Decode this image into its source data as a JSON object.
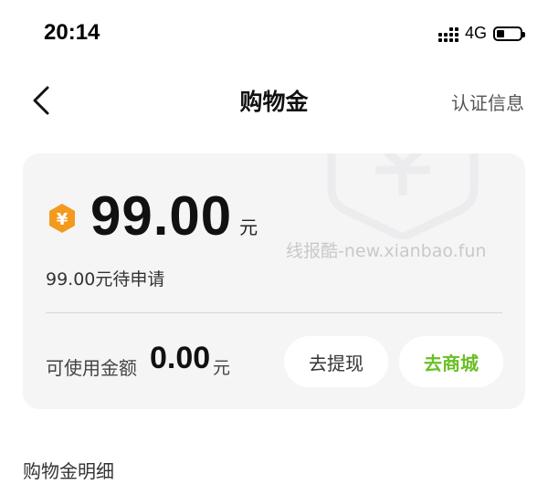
{
  "status_bar": {
    "time": "20:14",
    "network": "4G",
    "icons": [
      "signal-icon",
      "battery-icon"
    ]
  },
  "nav": {
    "back_icon": "chevron-left-icon",
    "title": "购物金",
    "right_label": "认证信息"
  },
  "balance_card": {
    "coin_icon": "yuan-coin-icon",
    "coin_symbol": "¥",
    "amount": "99.00",
    "amount_unit": "元",
    "pending_text": "99.00元待申请",
    "watermark": "线报酷-new.xianbao.fun",
    "available_label": "可使用金额",
    "available_amount": "0.00",
    "available_unit": "元",
    "withdraw_label": "去提现",
    "mall_label": "去商城"
  },
  "details": {
    "title": "购物金明细"
  },
  "colors": {
    "accent_green": "#6bbf26",
    "coin_orange": "#f39a1e",
    "card_bg": "#f5f5f6"
  }
}
